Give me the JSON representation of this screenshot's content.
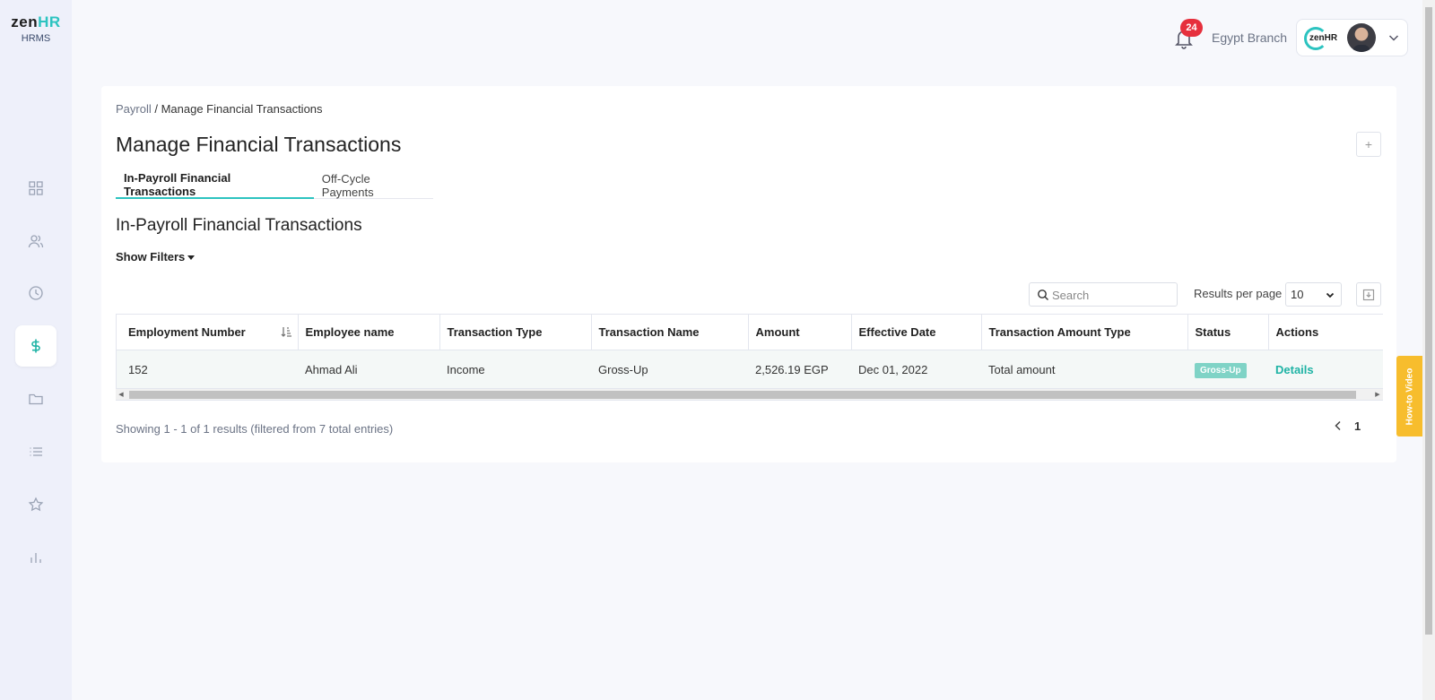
{
  "app": {
    "logo_zen": "zen",
    "logo_hr": "HR",
    "logo_sub": "HRMS"
  },
  "sidebar": {
    "items": [
      {
        "icon": "dashboard-icon",
        "active": false
      },
      {
        "icon": "people-icon",
        "active": false
      },
      {
        "icon": "clock-icon",
        "active": false
      },
      {
        "icon": "dollar-icon",
        "active": true
      },
      {
        "icon": "folder-icon",
        "active": false
      },
      {
        "icon": "list-icon",
        "active": false
      },
      {
        "icon": "star-icon",
        "active": false
      },
      {
        "icon": "bar-chart-icon",
        "active": false
      }
    ]
  },
  "header": {
    "notification_count": "24",
    "branch": "Egypt Branch",
    "account_logo_text": "zenHR"
  },
  "breadcrumb": {
    "parent": "Payroll",
    "separator": " / ",
    "current": "Manage Financial Transactions"
  },
  "page": {
    "title": "Manage Financial Transactions",
    "add_label": "+"
  },
  "tabs": [
    {
      "label": "In-Payroll Financial Transactions",
      "active": true
    },
    {
      "label": "Off-Cycle Payments",
      "active": false
    }
  ],
  "section": {
    "title": "In-Payroll Financial Transactions",
    "show_filters": "Show Filters"
  },
  "controls": {
    "search_placeholder": "Search",
    "results_per_page_label": "Results per page",
    "results_per_page_value": "10"
  },
  "table": {
    "columns": [
      "Employment Number",
      "Employee name",
      "Transaction Type",
      "Transaction Name",
      "Amount",
      "Effective Date",
      "Transaction Amount Type",
      "Status",
      "Actions"
    ],
    "rows": [
      {
        "employment_number": "152",
        "employee_name": "Ahmad Ali",
        "transaction_type": "Income",
        "transaction_name": "Gross-Up",
        "amount": "2,526.19 EGP",
        "effective_date": "Dec 01, 2022",
        "amount_type": "Total amount",
        "status": "Gross-Up",
        "action": "Details"
      }
    ]
  },
  "footer": {
    "showing": "Showing 1 - 1 of 1 results (filtered from 7 total entries)",
    "current_page": "1"
  },
  "howto": {
    "label": "How-to Video"
  },
  "colors": {
    "accent": "#2cc3c0",
    "link": "#1fb3a5",
    "badge": "#e6303d",
    "status": "#7fd3c6",
    "howto": "#f7bd2d"
  }
}
